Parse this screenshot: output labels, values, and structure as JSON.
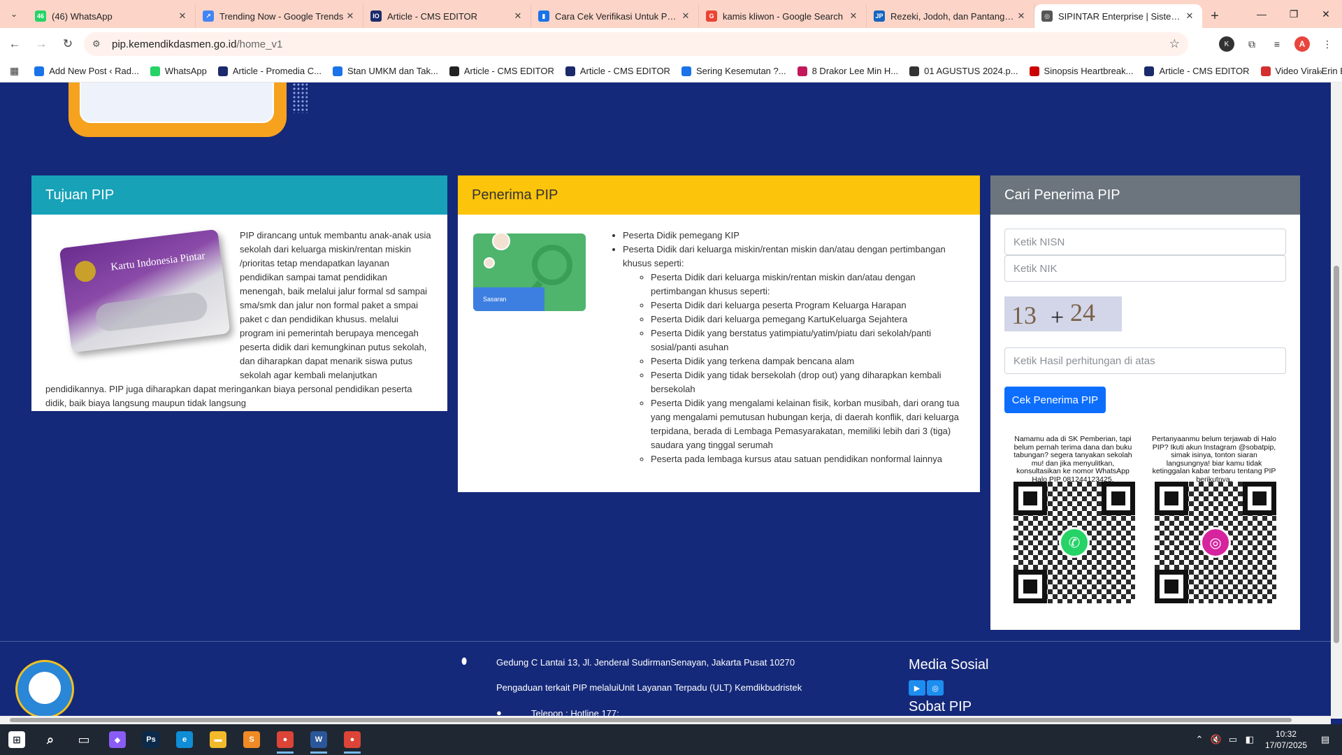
{
  "browser": {
    "tabs": [
      {
        "title": "(46) WhatsApp",
        "fav_color": "#25d366",
        "fav_text": "46"
      },
      {
        "title": "Trending Now - Google Trends",
        "fav_color": "#4285f4",
        "fav_text": "↗"
      },
      {
        "title": "Article - CMS EDITOR",
        "fav_color": "#1b2a6b",
        "fav_text": "IO"
      },
      {
        "title": "Cara Cek Verifikasi Untuk Penca",
        "fav_color": "#1a73e8",
        "fav_text": "▮"
      },
      {
        "title": "kamis kliwon - Google Search",
        "fav_color": "#ea4335",
        "fav_text": "G"
      },
      {
        "title": "Rezeki, Jodoh, dan Pantangan W",
        "fav_color": "#1565c0",
        "fav_text": "JP"
      },
      {
        "title": "SIPINTAR Enterprise | Sistem Inf",
        "fav_color": "#555555",
        "fav_text": "◎"
      }
    ],
    "active_tab_index": 6,
    "new_tab_icon": "+",
    "url_host": "pip.kemendikdasmen.go.id",
    "url_path": "/home_v1",
    "profile_initial": "A",
    "extension_initial": "K",
    "bookmarks": [
      {
        "label": "Add New Post ‹ Rad...",
        "color": "#1a73e8"
      },
      {
        "label": "WhatsApp",
        "color": "#25d366"
      },
      {
        "label": "Article - Promedia C...",
        "color": "#1b2a6b"
      },
      {
        "label": "Stan UMKM dan Tak...",
        "color": "#1a73e8"
      },
      {
        "label": "Article - CMS EDITOR",
        "color": "#222222"
      },
      {
        "label": "Article - CMS EDITOR",
        "color": "#1b2a6b"
      },
      {
        "label": "Sering Kesemutan ?...",
        "color": "#1a73e8"
      },
      {
        "label": "8 Drakor Lee Min H...",
        "color": "#c2185b"
      },
      {
        "label": "01 AGUSTUS 2024.p...",
        "color": "#333333"
      },
      {
        "label": "Sinopsis Heartbreak...",
        "color": "#cc0000"
      },
      {
        "label": "Article - CMS EDITOR",
        "color": "#1b2a6b"
      },
      {
        "label": "Video Viral Erin Bug...",
        "color": "#d32f2f"
      }
    ]
  },
  "tujuan": {
    "title": "Tujuan PIP",
    "card_label": "Kartu Indonesia Pintar",
    "text": "PIP dirancang untuk membantu anak-anak usia sekolah dari keluarga miskin/rentan miskin /prioritas tetap mendapatkan layanan pendidikan sampai tamat pendidikan menengah, baik melalui jalur formal sd sampai sma/smk dan jalur non formal paket a smpai paket c dan pendidikan khusus. melalui program ini pemerintah berupaya mencegah peserta didik dari kemungkinan putus sekolah, dan diharapkan dapat menarik siswa putus sekolah agar kembali melanjutkan pendidikannya. PIP juga diharapkan dapat meringankan biaya personal pendidikan peserta didik, baik biaya langsung maupun tidak langsung"
  },
  "penerima": {
    "title": "Penerima PIP",
    "image_caption": "Sasaran",
    "item1": "Peserta Didik pemegang KIP",
    "item2": "Peserta Didik dari keluarga miskin/rentan miskin dan/atau dengan pertimbangan khusus seperti:",
    "sub": [
      "Peserta Didik dari keluarga miskin/rentan miskin dan/atau dengan pertimbangan khusus seperti:",
      "Peserta Didik dari keluarga peserta Program Keluarga Harapan",
      "Peserta Didik dari keluarga pemegang KartuKeluarga Sejahtera",
      "Peserta Didik yang berstatus yatimpiatu/yatim/piatu dari sekolah/panti sosial/panti asuhan",
      "Peserta Didik yang terkena dampak bencana alam",
      "Peserta Didik yang tidak bersekolah (drop out) yang diharapkan kembali bersekolah",
      "Peserta Didik yang mengalami kelainan fisik, korban musibah, dari orang tua yang mengalami pemutusan hubungan kerja, di daerah konflik, dari keluarga terpidana, berada di Lembaga Pemasyarakatan, memiliki lebih dari 3 (tiga) saudara yang tinggal serumah",
      "Peserta pada lembaga kursus atau satuan pendidikan nonformal lainnya"
    ]
  },
  "cari": {
    "title": "Cari Penerima PIP",
    "nisn_placeholder": "Ketik NISN",
    "nik_placeholder": "Ketik NIK",
    "captcha_a": "13",
    "captcha_op": "+",
    "captcha_b": "24",
    "hasil_placeholder": "Ketik Hasil perhitungan di atas",
    "button_label": "Cek Penerima PIP",
    "wa_text": "Namamu ada di SK Pemberian, tapi belum pernah terima dana dan buku tabungan? segera tanyakan sekolah mu! dan jika menyulitkan, konsultasikan ke nomor WhatsApp Halo PIP 081244123425.",
    "ig_text": "Pertanyaanmu belum terjawab di Halo PIP? Ikuti akun Instagram @sobatpip, simak isinya, tonton siaran langsungnya! biar kamu tidak ketinggalan kabar terbaru tentang PIP berikutnya.",
    "wa_color": "#25d366",
    "ig_color": "#d6249f"
  },
  "footer": {
    "address": "Gedung C Lantai 13, Jl. Jenderal SudirmanSenayan, Jakarta Pusat 10270",
    "pengaduan": "Pengaduan terkait PIP melaluiUnit Layanan Terpadu (ULT) Kemdikbudristek",
    "telepon": "Telepon : Hotline 177;",
    "media_title": "Media Sosial",
    "sobat_title": "Sobat PIP"
  },
  "taskbar": {
    "apps": [
      {
        "name": "search",
        "color": "transparent",
        "text": "⌕"
      },
      {
        "name": "task-view",
        "color": "transparent",
        "text": "▭"
      },
      {
        "name": "copilot",
        "color": "#8a5cf6",
        "text": "◆"
      },
      {
        "name": "photoshop",
        "color": "#0b2a4a",
        "text": "Ps"
      },
      {
        "name": "edge",
        "color": "#0f8dd6",
        "text": "e"
      },
      {
        "name": "explorer",
        "color": "#f2b92a",
        "text": "▬"
      },
      {
        "name": "sublime",
        "color": "#f08a24",
        "text": "S"
      },
      {
        "name": "chrome",
        "color": "#db4437",
        "text": "●"
      },
      {
        "name": "word",
        "color": "#2b579a",
        "text": "W"
      },
      {
        "name": "chrome-2",
        "color": "#db4437",
        "text": "●"
      }
    ],
    "time": "10:32",
    "date": "17/07/2025"
  }
}
